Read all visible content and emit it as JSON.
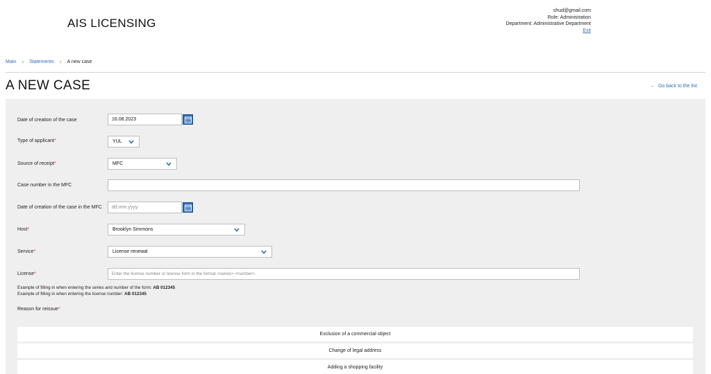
{
  "header": {
    "app_title": "AIS LICENSING",
    "user_email": "shud@gmail.com",
    "user_role": "Role: Administration",
    "user_department": "Department: Administrative Department",
    "exit_label": "Exit"
  },
  "breadcrumb": {
    "items": [
      "Main",
      "Statements",
      "A new case"
    ]
  },
  "page": {
    "title": "A NEW CASE",
    "back_label": "Go back to the list"
  },
  "form": {
    "date_created": {
      "label": "Date of creation of the case",
      "value": "16.08.2023"
    },
    "applicant_type": {
      "label": "Type of applicant",
      "value": "YUL"
    },
    "source": {
      "label": "Source of receipt",
      "value": "MFC"
    },
    "mfc_case_number": {
      "label": "Case number in the MFC",
      "value": ""
    },
    "mfc_date": {
      "label": "Date of creation of the case in the MFC",
      "placeholder": "dd.mm.yyyy"
    },
    "host": {
      "label": "Host",
      "value": "Brooklyn Simmons"
    },
    "service": {
      "label": "Service",
      "value": "License renewal"
    },
    "license": {
      "label": "License",
      "placeholder": "Enter the license number or license form in the format <series> <number>",
      "hint1_text": "Example of filling in when entering the series and number of the form: ",
      "hint1_value": "AB 012345",
      "hint2_text": "Example of filling in when entering the license number: ",
      "hint2_value": "AB 012345"
    },
    "reason": {
      "label": "Reason for reissue",
      "options": [
        "Exclusion of a commercial object",
        "Change of legal address",
        "Adding a shopping facility"
      ]
    },
    "required_mark": "*"
  },
  "colors": {
    "accent": "#2f6db5",
    "panel_bg": "#efefef",
    "required": "#dd3333"
  }
}
